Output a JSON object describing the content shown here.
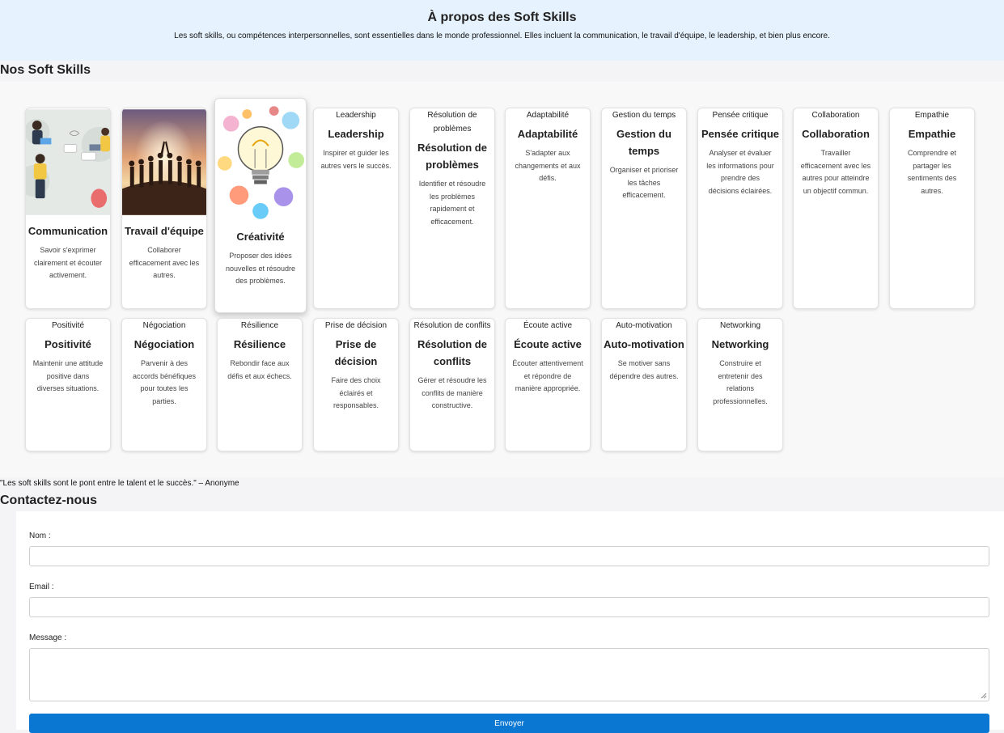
{
  "about": {
    "title": "À propos des Soft Skills",
    "text": "Les soft skills, ou compétences interpersonnelles, sont essentielles dans le monde professionnel. Elles incluent la communication, le travail d'équipe, le leadership, et bien plus encore."
  },
  "skills": {
    "heading": "Nos Soft Skills",
    "cards": [
      {
        "title": "Communication",
        "text": "Savoir s'exprimer clairement et écouter activement.",
        "image": "communication-illustration"
      },
      {
        "title": "Travail d'équipe",
        "text": "Collaborer efficacement avec les autres.",
        "image": "teamwork-photo"
      },
      {
        "title": "Créativité",
        "text": "Proposer des idées nouvelles et résoudre des problèmes.",
        "image": "creativity-lightbulb"
      },
      {
        "title": "Leadership",
        "text": "Inspirer et guider les autres vers le succès.",
        "alt": "Leadership"
      },
      {
        "title": "Résolution de problèmes",
        "text": "Identifier et résoudre les problèmes rapidement et efficacement.",
        "alt": "Résolution de problèmes"
      },
      {
        "title": "Adaptabilité",
        "text": "S'adapter aux changements et aux défis.",
        "alt": "Adaptabilité"
      },
      {
        "title": "Gestion du temps",
        "text": "Organiser et prioriser les tâches efficacement.",
        "alt": "Gestion du temps"
      },
      {
        "title": "Pensée critique",
        "text": "Analyser et évaluer les informations pour prendre des décisions éclairées.",
        "alt": "Pensée critique"
      },
      {
        "title": "Collaboration",
        "text": "Travailler efficacement avec les autres pour atteindre un objectif commun.",
        "alt": "Collaboration"
      },
      {
        "title": "Empathie",
        "text": "Comprendre et partager les sentiments des autres.",
        "alt": "Empathie"
      },
      {
        "title": "Positivité",
        "text": "Maintenir une attitude positive dans diverses situations.",
        "alt": "Positivité"
      },
      {
        "title": "Négociation",
        "text": "Parvenir à des accords bénéfiques pour toutes les parties.",
        "alt": "Négociation"
      },
      {
        "title": "Résilience",
        "text": "Rebondir face aux défis et aux échecs.",
        "alt": "Résilience"
      },
      {
        "title": "Prise de décision",
        "text": "Faire des choix éclairés et responsables.",
        "alt": "Prise de décision"
      },
      {
        "title": "Résolution de conflits",
        "text": "Gérer et résoudre les conflits de manière constructive.",
        "alt": "Résolution de conflits"
      },
      {
        "title": "Écoute active",
        "text": "Écouter attentivement et répondre de manière appropriée.",
        "alt": "Écoute active"
      },
      {
        "title": "Auto-motivation",
        "text": "Se motiver sans dépendre des autres.",
        "alt": "Auto-motivation"
      },
      {
        "title": "Networking",
        "text": "Construire et entretenir des relations professionnelles.",
        "alt": "Networking"
      }
    ]
  },
  "quote": "\"Les soft skills sont le pont entre le talent et le succès.\" – Anonyme",
  "contact": {
    "heading": "Contactez-nous",
    "name_label": "Nom :",
    "email_label": "Email :",
    "message_label": "Message :",
    "submit_label": "Envoyer"
  },
  "colors": {
    "about_bg": "#e6f2fd",
    "button": "#0a78d3"
  }
}
